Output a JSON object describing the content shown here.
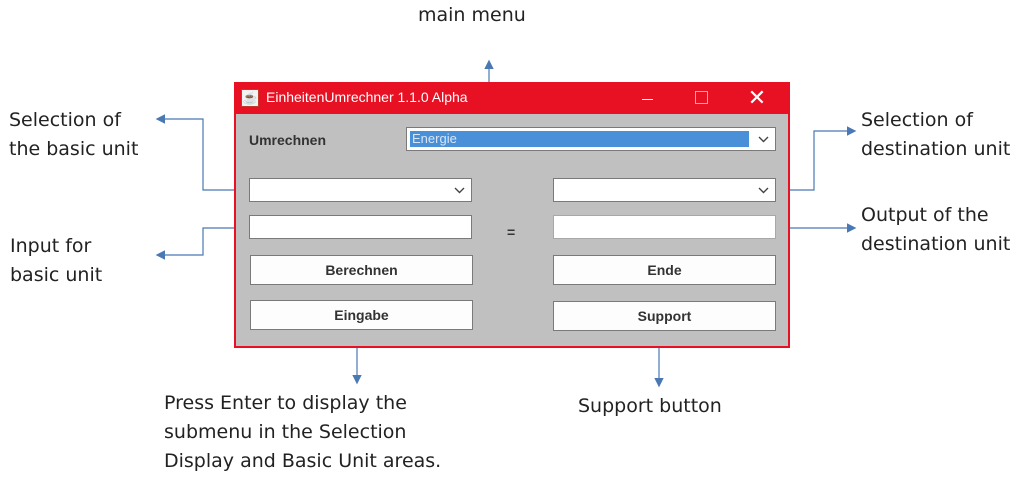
{
  "annotations": {
    "main_menu": "main menu",
    "basic_unit_selection": [
      "Selection of",
      "the basic unit"
    ],
    "destination_unit_selection": [
      "Selection of",
      "destination unit"
    ],
    "basic_unit_input": [
      "Input for",
      "basic unit"
    ],
    "destination_output": [
      "Output of the",
      "destination unit"
    ],
    "enter_note": [
      "Press Enter to display the",
      "submenu in the Selection",
      "Display and Basic Unit areas."
    ],
    "support_button_note": "Support button"
  },
  "window": {
    "title": "EinheitenUmrechner 1.1.0 Alpha",
    "controls": {
      "minimize": "minimize-icon",
      "maximize": "maximize-icon",
      "close": "close-icon"
    }
  },
  "form": {
    "umrechnen_label": "Umrechnen",
    "main_menu_selected": "Energie",
    "basic_unit_value": "",
    "destination_unit_value": "",
    "input_value": "",
    "output_value": "",
    "equals": "=",
    "buttons": {
      "berechnen": "Berechnen",
      "ende": "Ende",
      "eingabe": "Eingabe",
      "support": "Support"
    }
  },
  "colors": {
    "titlebar": "#e81123",
    "content": "#c0c0c0",
    "selection": "#4a90d9",
    "arrow_lines": "#4a78b4"
  }
}
